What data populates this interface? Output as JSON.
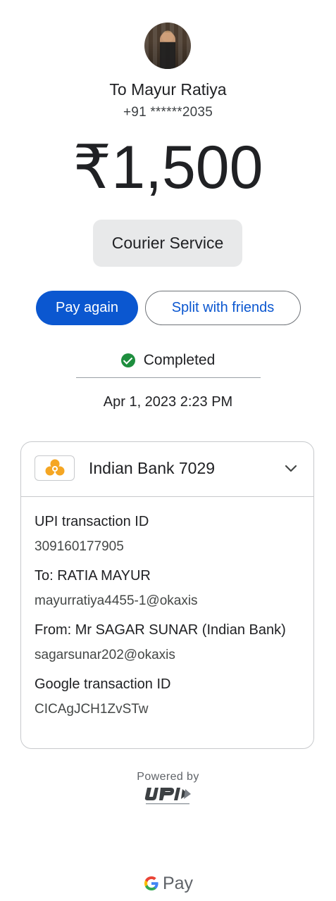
{
  "recipient": {
    "to_name": "To Mayur Ratiya",
    "phone": "+91 ******2035"
  },
  "amount": "₹1,500",
  "note": "Courier Service",
  "actions": {
    "pay_again": "Pay again",
    "split": "Split with friends"
  },
  "status": {
    "text": "Completed",
    "color": "#1e8e3e"
  },
  "datetime": "Apr 1, 2023 2:23 PM",
  "bank_card": {
    "bank": "Indian Bank 7029",
    "fields": [
      {
        "label": "UPI transaction ID",
        "value": "309160177905"
      },
      {
        "label": "To: RATIA  MAYUR",
        "value": "mayurratiya4455-1@okaxis"
      },
      {
        "label": "From: Mr SAGAR SUNAR (Indian Bank)",
        "value": "sagarsunar202@okaxis"
      },
      {
        "label": "Google transaction ID",
        "value": "CICAgJCH1ZvSTw"
      }
    ]
  },
  "footer": {
    "powered_by": "Powered by",
    "upi_logo": "UPI",
    "brand": "Pay"
  },
  "colors": {
    "primary": "#0b57d0",
    "chip_bg": "#e8e9ea"
  }
}
